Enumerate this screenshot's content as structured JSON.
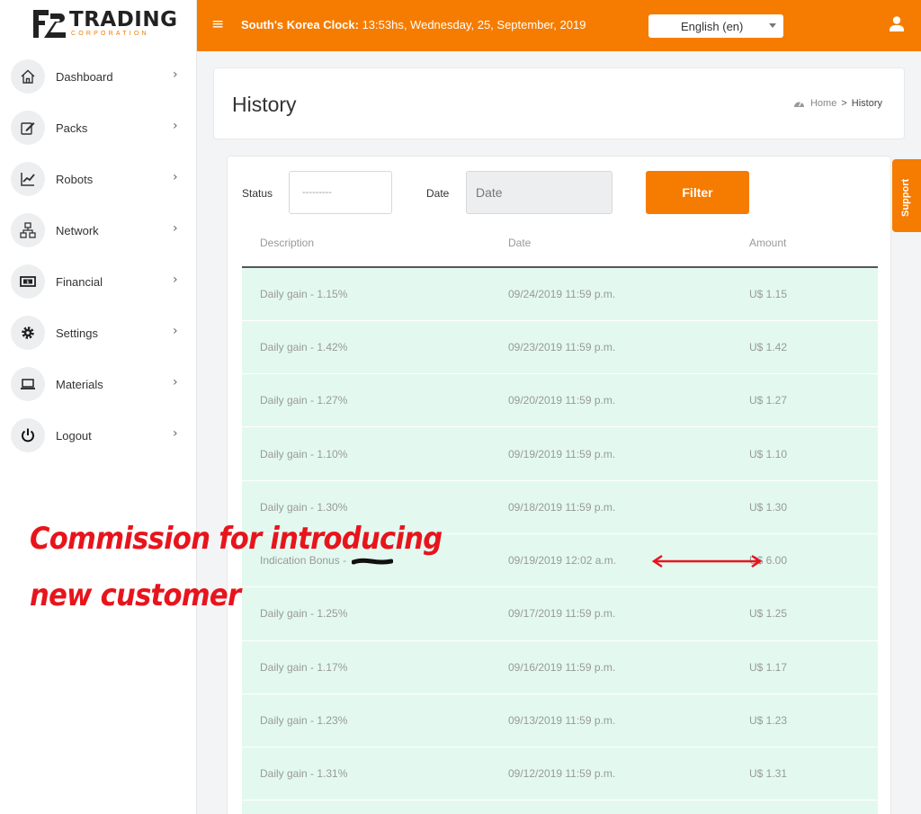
{
  "brand": {
    "name": "TRADING",
    "subtitle": "CORPORATION"
  },
  "header": {
    "clock_label": "South's Korea Clock:",
    "clock_value": " 13:53hs, Wednesday, 25, September, 2019",
    "language": "English (en)",
    "menu_icon": "hamburger-icon",
    "user_icon": "user-icon",
    "accent_color": "#f57c00"
  },
  "sidebar": {
    "items": [
      {
        "label": "Dashboard",
        "icon": "home-icon"
      },
      {
        "label": "Packs",
        "icon": "edit-icon"
      },
      {
        "label": "Robots",
        "icon": "chart-line-icon"
      },
      {
        "label": "Network",
        "icon": "network-icon"
      },
      {
        "label": "Financial",
        "icon": "money-icon"
      },
      {
        "label": "Settings",
        "icon": "gear-icon"
      },
      {
        "label": "Materials",
        "icon": "laptop-icon"
      },
      {
        "label": "Logout",
        "icon": "power-icon"
      }
    ]
  },
  "page": {
    "title": "History",
    "breadcrumb": {
      "home": "Home",
      "separator": ">",
      "current": "History"
    }
  },
  "filters": {
    "status_label": "Status",
    "status_value": "---------",
    "date_label": "Date",
    "date_placeholder": "Date",
    "filter_label": "Filter"
  },
  "table": {
    "columns": [
      "Description",
      "Date",
      "Amount"
    ],
    "rows": [
      {
        "description": "Daily gain - 1.15%",
        "date": "09/24/2019 11:59 p.m.",
        "amount": "U$ 1.15"
      },
      {
        "description": "Daily gain - 1.42%",
        "date": "09/23/2019 11:59 p.m.",
        "amount": "U$ 1.42"
      },
      {
        "description": "Daily gain - 1.27%",
        "date": "09/20/2019 11:59 p.m.",
        "amount": "U$ 1.27"
      },
      {
        "description": "Daily gain - 1.10%",
        "date": "09/19/2019 11:59 p.m.",
        "amount": "U$ 1.10"
      },
      {
        "description": "Daily gain - 1.30%",
        "date": "09/18/2019 11:59 p.m.",
        "amount": "U$ 1.30"
      },
      {
        "description": "Indication Bonus -",
        "date": "09/19/2019 12:02 a.m.",
        "amount": "U$ 6.00"
      },
      {
        "description": "Daily gain - 1.25%",
        "date": "09/17/2019 11:59 p.m.",
        "amount": "U$ 1.25"
      },
      {
        "description": "Daily gain - 1.17%",
        "date": "09/16/2019 11:59 p.m.",
        "amount": "U$ 1.17"
      },
      {
        "description": "Daily gain - 1.23%",
        "date": "09/13/2019 11:59 p.m.",
        "amount": "U$ 1.23"
      },
      {
        "description": "Daily gain - 1.31%",
        "date": "09/12/2019 11:59 p.m.",
        "amount": "U$ 1.31"
      },
      {
        "description": "",
        "date": "",
        "amount": ""
      }
    ]
  },
  "support_label": "Support",
  "annotation": {
    "line1": "Commission for introducing",
    "line2": "new customer",
    "color": "#e8141c"
  }
}
